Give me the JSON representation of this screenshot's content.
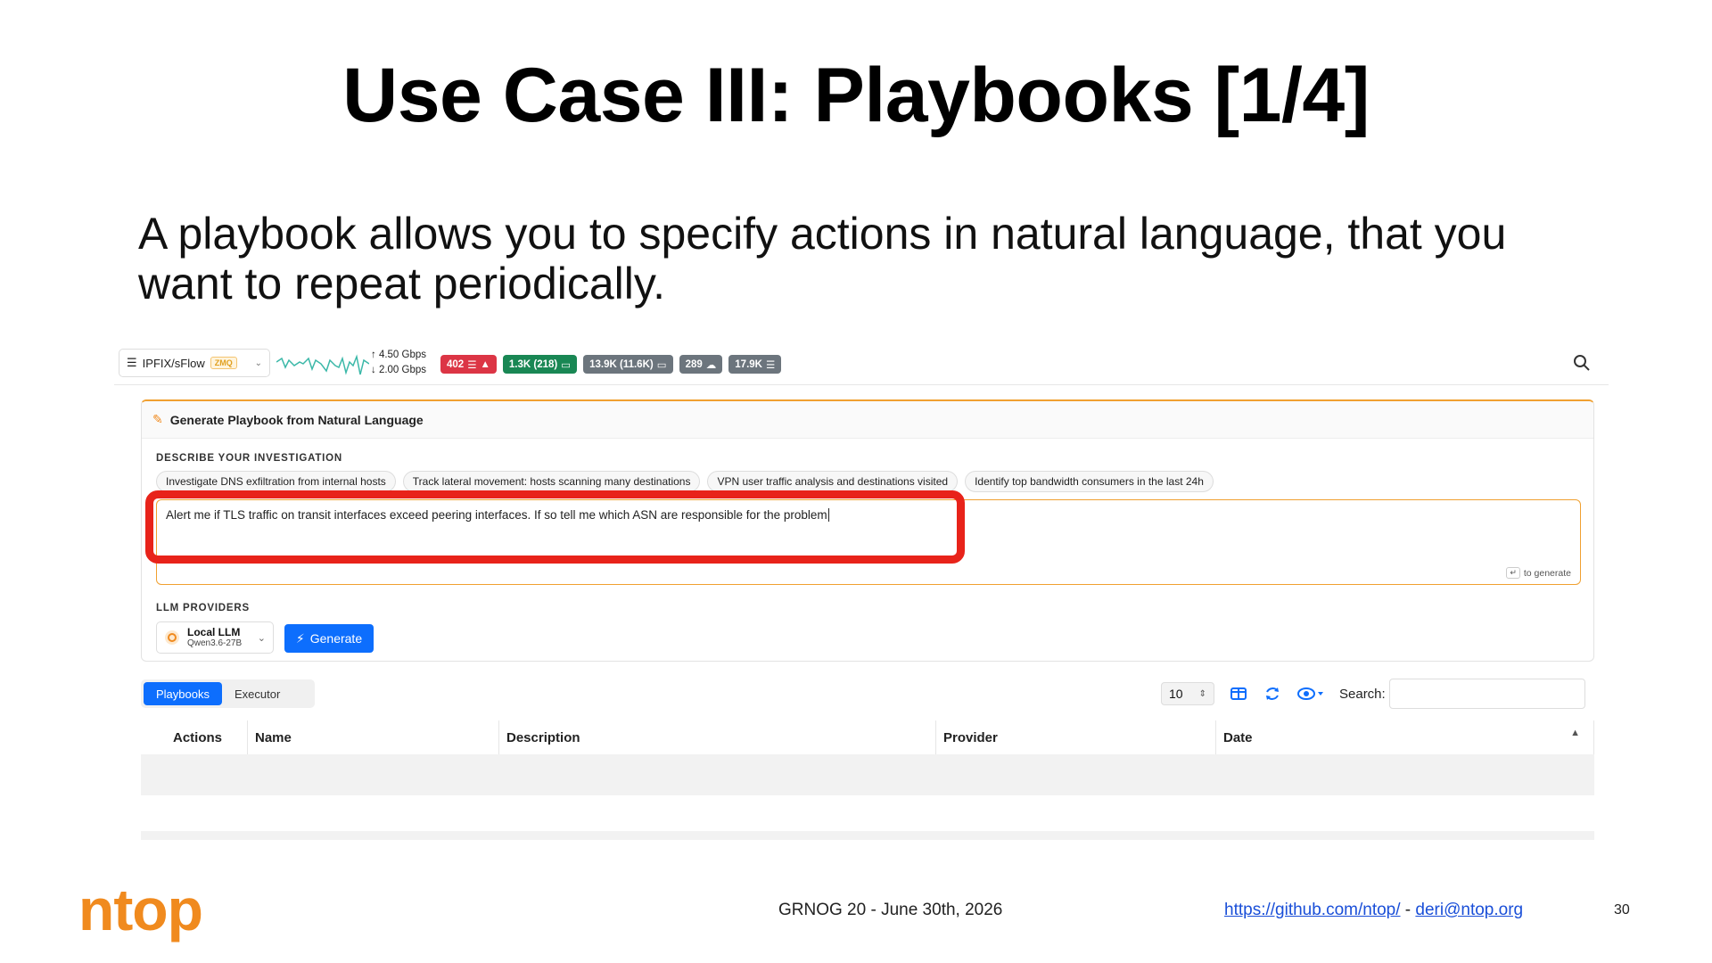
{
  "slide": {
    "title": "Use Case III: Playbooks [1/4]",
    "body": "A playbook allows you to specify actions in natural language, that you want to repeat periodically.",
    "footer_logo": "ntop",
    "footer_center": "GRNOG 20 - June 30th, 2026",
    "footer_link_github": "https://github.com/ntop/",
    "footer_separator": " - ",
    "footer_link_email": "deri@ntop.org",
    "page_number": "30"
  },
  "topbar": {
    "interface_label": "IPFIX/sFlow",
    "interface_badge": "ZMQ",
    "rate_up": "↑ 4.50 Gbps",
    "rate_down": "↓ 2.00 Gbps",
    "pills": [
      {
        "label": "402",
        "color": "#dc3545",
        "icon": "warning-icon"
      },
      {
        "label": "1.3K (218)",
        "color": "#198754",
        "icon": "laptop-icon"
      },
      {
        "label": "13.9K (11.6K)",
        "color": "#6c757d",
        "icon": "laptop-icon"
      },
      {
        "label": "289",
        "color": "#6c757d",
        "icon": "cloud-icon"
      },
      {
        "label": "17.9K",
        "color": "#6c757d",
        "icon": "list-icon"
      }
    ]
  },
  "card": {
    "header": "Generate Playbook from Natural Language",
    "describe_label": "DESCRIBE YOUR INVESTIGATION",
    "suggestions": [
      "Investigate DNS exfiltration from internal hosts",
      "Track lateral movement: hosts scanning many destinations",
      "VPN user traffic analysis and destinations visited",
      "Identify top bandwidth consumers in the last 24h"
    ],
    "prompt_text": "Alert me if TLS traffic on transit interfaces exceed peering interfaces. If so tell me which ASN are responsible for the problem",
    "hint_key": "↵",
    "hint_text": "to generate",
    "providers_label": "LLM PROVIDERS",
    "provider_name": "Local LLM",
    "provider_model": "Qwen3.6-27B",
    "generate_label": "Generate"
  },
  "table": {
    "tabs": [
      "Playbooks",
      "Executor"
    ],
    "page_size": "10",
    "search_label": "Search:",
    "search_value": "",
    "columns": [
      "Actions",
      "Name",
      "Description",
      "Provider",
      "Date"
    ]
  }
}
